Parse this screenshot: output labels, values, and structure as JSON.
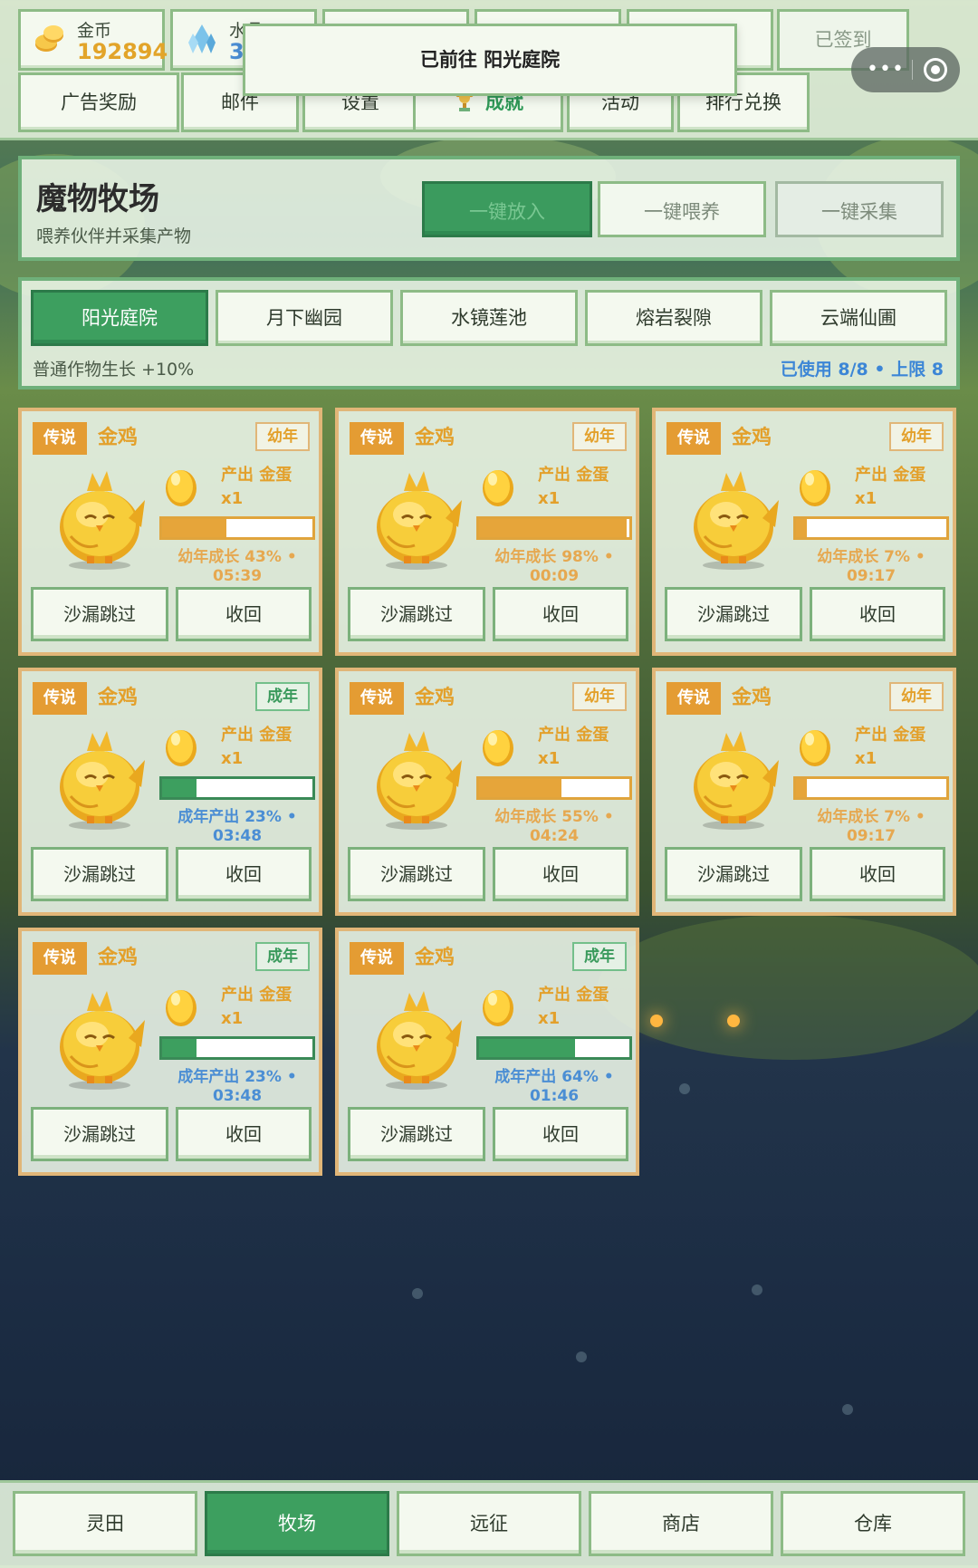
{
  "header": {
    "resources": [
      {
        "label": "金币",
        "value": "192894",
        "icon": "gold-coins-icon"
      },
      {
        "label": "水晶",
        "value": "3",
        "icon": "crystal-icon"
      }
    ],
    "checkin_label": "已签到",
    "nav": [
      {
        "label": "广告奖励",
        "active": false
      },
      {
        "label": "邮件",
        "active": false
      },
      {
        "label": "设置",
        "active": false
      },
      {
        "label": "成就",
        "active": true,
        "icon": "trophy-icon"
      },
      {
        "label": "活动",
        "active": false
      },
      {
        "label": "排行兑换",
        "active": false
      }
    ],
    "toast": "已前往 阳光庭院",
    "capsule_more": "•••"
  },
  "ranch": {
    "title": "魔物牧场",
    "subtitle": "喂养伙伴并采集产物",
    "actions": {
      "release": "一键放入",
      "feed": "一键喂养",
      "collect": "一键采集"
    }
  },
  "areas": {
    "tabs": [
      "阳光庭院",
      "月下幽园",
      "水镜莲池",
      "熔岩裂隙",
      "云端仙圃"
    ],
    "active_index": 0,
    "bonus": "普通作物生长 +10%",
    "usage": "已使用 8/8 • 上限 8"
  },
  "pets": [
    {
      "rarity": "传说",
      "name": "金鸡",
      "stage": "幼年",
      "produce": "产出 金蛋",
      "qty": "x1",
      "progress": 0.43,
      "status": "幼年成长 43% •",
      "time": "05:39",
      "skip_label": "沙漏跳过",
      "recall_label": "收回"
    },
    {
      "rarity": "传说",
      "name": "金鸡",
      "stage": "幼年",
      "produce": "产出 金蛋",
      "qty": "x1",
      "progress": 0.98,
      "status": "幼年成长 98% •",
      "time": "00:09",
      "skip_label": "沙漏跳过",
      "recall_label": "收回"
    },
    {
      "rarity": "传说",
      "name": "金鸡",
      "stage": "幼年",
      "produce": "产出 金蛋",
      "qty": "x1",
      "progress": 0.07,
      "status": "幼年成长 7% •",
      "time": "09:17",
      "skip_label": "沙漏跳过",
      "recall_label": "收回"
    },
    {
      "rarity": "传说",
      "name": "金鸡",
      "stage": "成年",
      "produce": "产出 金蛋",
      "qty": "x1",
      "progress": 0.23,
      "status": "成年产出 23% •",
      "time": "03:48",
      "skip_label": "沙漏跳过",
      "recall_label": "收回"
    },
    {
      "rarity": "传说",
      "name": "金鸡",
      "stage": "幼年",
      "produce": "产出 金蛋",
      "qty": "x1",
      "progress": 0.55,
      "status": "幼年成长 55% •",
      "time": "04:24",
      "skip_label": "沙漏跳过",
      "recall_label": "收回"
    },
    {
      "rarity": "传说",
      "name": "金鸡",
      "stage": "幼年",
      "produce": "产出 金蛋",
      "qty": "x1",
      "progress": 0.07,
      "status": "幼年成长 7% •",
      "time": "09:17",
      "skip_label": "沙漏跳过",
      "recall_label": "收回"
    },
    {
      "rarity": "传说",
      "name": "金鸡",
      "stage": "成年",
      "produce": "产出 金蛋",
      "qty": "x1",
      "progress": 0.23,
      "status": "成年产出 23% •",
      "time": "03:48",
      "skip_label": "沙漏跳过",
      "recall_label": "收回"
    },
    {
      "rarity": "传说",
      "name": "金鸡",
      "stage": "成年",
      "produce": "产出 金蛋",
      "qty": "x1",
      "progress": 0.64,
      "status": "成年产出 64% •",
      "time": "01:46",
      "skip_label": "沙漏跳过",
      "recall_label": "收回"
    }
  ],
  "bottom_nav": {
    "tabs": [
      "灵田",
      "牧场",
      "远征",
      "商店",
      "仓库"
    ],
    "active_index": 1
  },
  "colors": {
    "accent_green": "#3d9f5f",
    "gold": "#e3a02b",
    "blue_text": "#3c86d6"
  }
}
